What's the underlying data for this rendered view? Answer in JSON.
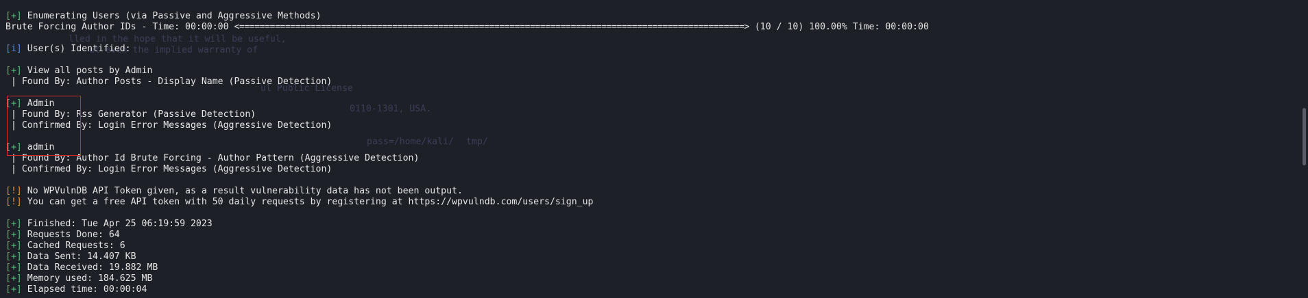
{
  "ghost": {
    "g1": "lled in the hope that it will be useful,",
    "g2": "ut even the implied warranty of",
    "g3": "ul Public License",
    "g4": "0110-1301, USA.",
    "g5": "pass=/home/kali/",
    "g6": "tmp/"
  },
  "lines": {
    "enum_tag": "[+]",
    "enum_text": " Enumerating Users (via Passive and Aggressive Methods)",
    "brute_label": "Brute Forcing Author IDs - Time: 00:00:00 ",
    "brute_bar": "<===================================================================================================>",
    "brute_status": " (10 / 10) 100.00% Time: 00:00:00",
    "ident_tag": "[i]",
    "ident_text": " User(s) Identified:",
    "u1_tag": "[+]",
    "u1_name": " View all posts by Admin",
    "u1_found": " | Found By: Author Posts - Display Name (Passive Detection)",
    "u2_tag": "[+]",
    "u2_name": " Admin",
    "u2_found": " | Found By: Rss Generator (Passive Detection)",
    "u2_confirmed": " | Confirmed By: Login Error Messages (Aggressive Detection)",
    "u3_tag": "[+]",
    "u3_name": " admin",
    "u3_found": " | Found By: Author Id Brute Forcing - Author Pattern (Aggressive Detection)",
    "u3_confirmed": " | Confirmed By: Login Error Messages (Aggressive Detection)",
    "warn1_tag": "[!]",
    "warn1_text": " No WPVulnDB API Token given, as a result vulnerability data has not been output.",
    "warn2_tag": "[!]",
    "warn2_text": " You can get a free API token with 50 daily requests by registering at https://wpvulndb.com/users/sign_up",
    "fin_tag": "[+]",
    "fin_text": " Finished: Tue Apr 25 06:19:59 2023",
    "req_tag": "[+]",
    "req_text": " Requests Done: 64",
    "cached_tag": "[+]",
    "cached_text": " Cached Requests: 6",
    "sent_tag": "[+]",
    "sent_text": " Data Sent: 14.407 KB",
    "recv_tag": "[+]",
    "recv_text": " Data Received: 19.882 MB",
    "mem_tag": "[+]",
    "mem_text": " Memory used: 184.625 MB",
    "elapsed_tag": "[+]",
    "elapsed_text": " Elapsed time: 00:00:04"
  },
  "colors": {
    "background": "#1e2028",
    "success_tag": "#52c17a",
    "info_tag": "#4f8fe6",
    "warning_tag": "#e3902e",
    "highlight_box": "#d62a2a"
  }
}
